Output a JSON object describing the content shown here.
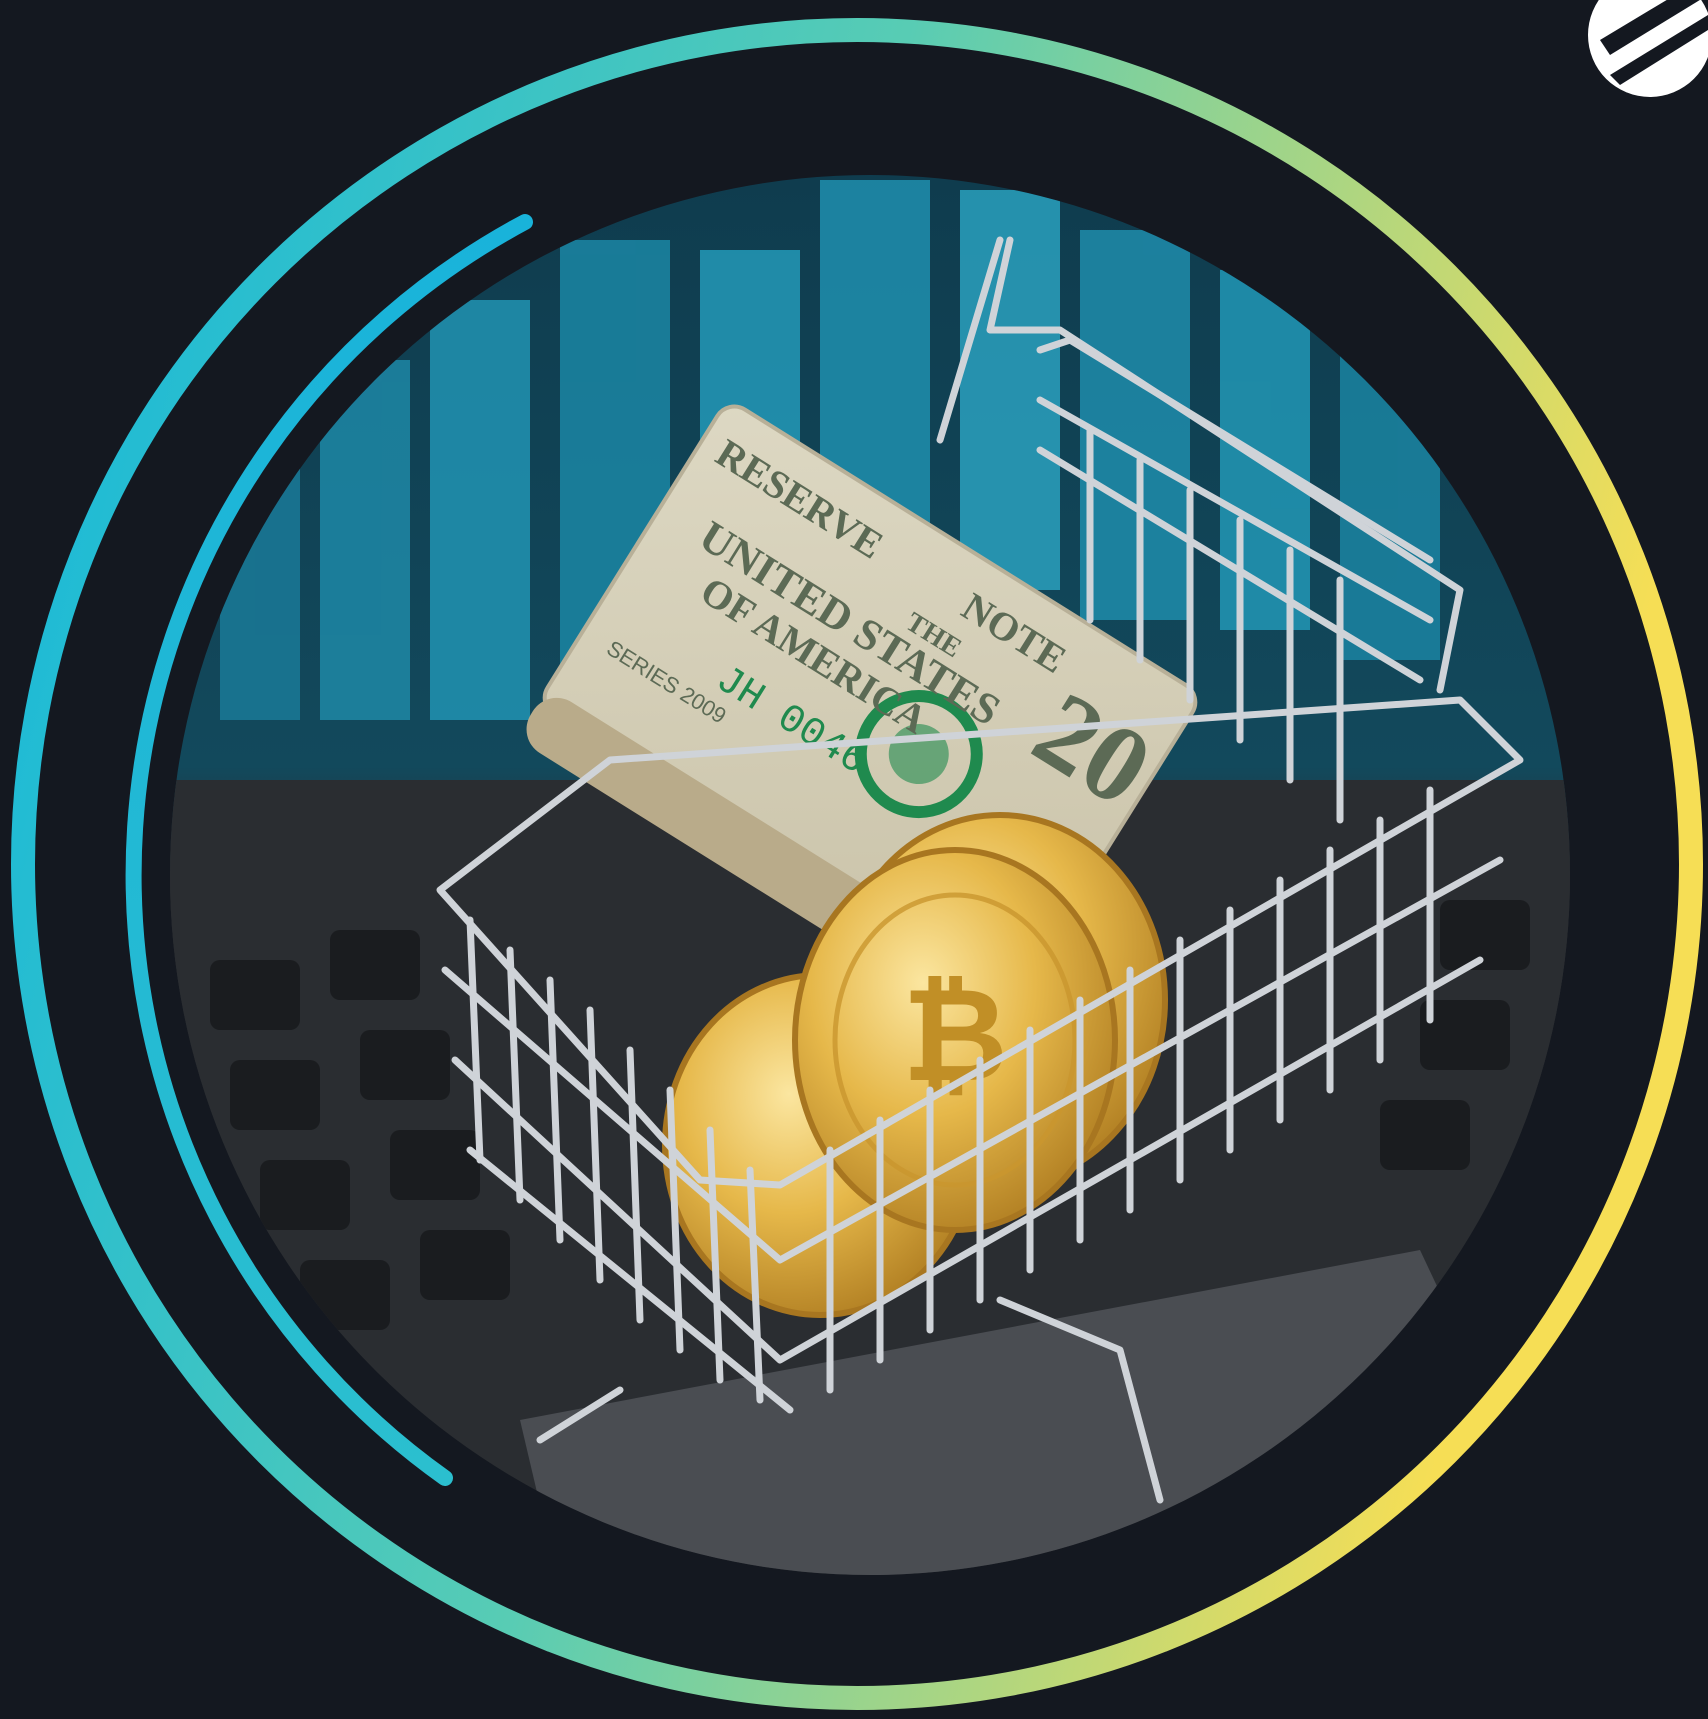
{
  "colors": {
    "background": "#141820",
    "ring_gradient_start": "#13b7dc",
    "ring_gradient_mid": "#58ccb4",
    "ring_gradient_end": "#f6de55",
    "inner_arc": "#1bbad8",
    "photo_teal": "#1f8fae",
    "laptop_gray": "#3a3d42",
    "cart_silver": "#d5d8dc",
    "bill_paper": "#d8d3bd",
    "bill_ink": "#5c6a55",
    "bill_green": "#1f8a4e",
    "coin_gold": "#e2b13c"
  },
  "icons": {
    "corner_logo": "partial-circle-logo-icon"
  },
  "photo": {
    "subject": "shopping-cart-with-cash-and-coins",
    "banknote_text": {
      "reserve": "RESERVE",
      "note": "NOTE",
      "the": "THE",
      "united_states": "UNITED STATES",
      "of_america": "OF AMERICA",
      "denomination": "20",
      "series": "SERIES 2009",
      "serial": "JH 0046"
    }
  }
}
